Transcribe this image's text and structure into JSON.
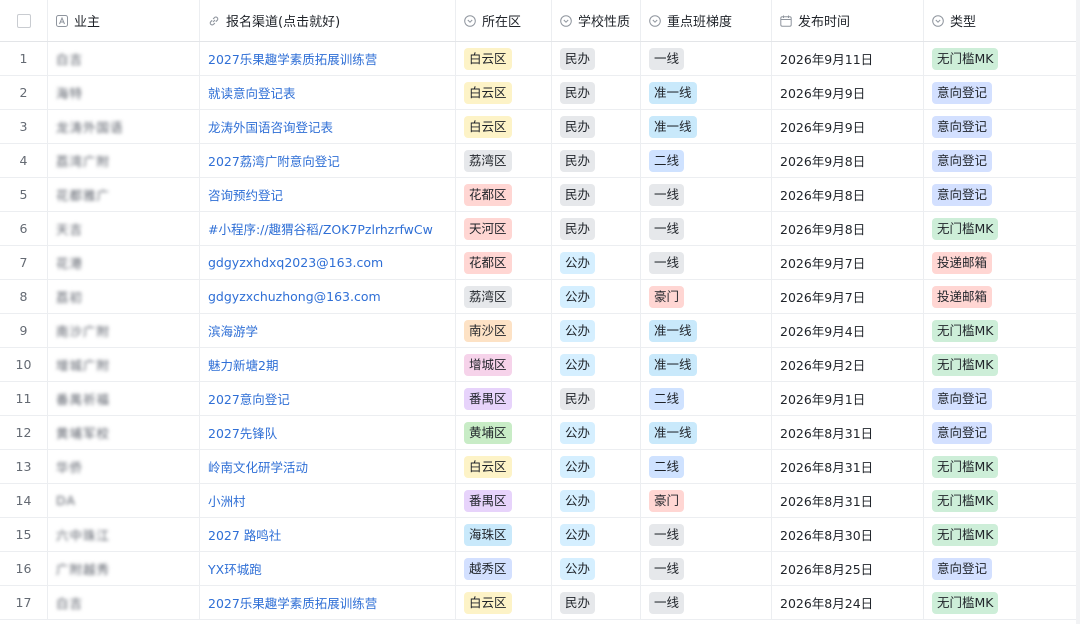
{
  "columns": [
    {
      "label": "",
      "icon": "checkbox-icon"
    },
    {
      "label": "业主",
      "icon": "text-field-icon"
    },
    {
      "label": "报名渠道(点击就好)",
      "icon": "link-icon"
    },
    {
      "label": "所在区",
      "icon": "dropdown-circle-icon"
    },
    {
      "label": "学校性质",
      "icon": "dropdown-circle-icon"
    },
    {
      "label": "重点班梯度",
      "icon": "dropdown-circle-icon"
    },
    {
      "label": "发布时间",
      "icon": "calendar-icon"
    },
    {
      "label": "类型",
      "icon": "dropdown-circle-icon"
    }
  ],
  "tag_colors": {
    "白云区": "#fdf3c7",
    "荔湾区": "#e6e8eb",
    "花都区": "#ffd6d3",
    "天河区": "#ffd6d3",
    "南沙区": "#fde2c5",
    "增城区": "#f6d3ea",
    "番禺区": "#e7d3fb",
    "黄埔区": "#c8ecc6",
    "海珠区": "#c9e9fb",
    "越秀区": "#d3e0ff",
    "民办": "#e6e8eb",
    "公办": "#d5efff",
    "一线": "#e6e8eb",
    "准一线": "#c9e9fb",
    "二线": "#cfe2ff",
    "豪门": "#ffd6d3",
    "无门槛MK": "#cdeed8",
    "意向登记": "#d3e0ff",
    "投递邮箱": "#ffd6d3"
  },
  "rows": [
    {
      "num": "1",
      "owner": "白吉",
      "channel": "2027乐果趣学素质拓展训练营",
      "district": "白云区",
      "nature": "民办",
      "tier": "一线",
      "date": "2026年9月11日",
      "type": "无门槛MK"
    },
    {
      "num": "2",
      "owner": "海特",
      "channel": "就读意向登记表",
      "district": "白云区",
      "nature": "民办",
      "tier": "准一线",
      "date": "2026年9月9日",
      "type": "意向登记"
    },
    {
      "num": "3",
      "owner": "龙涛外国语",
      "channel": "龙涛外国语咨询登记表",
      "district": "白云区",
      "nature": "民办",
      "tier": "准一线",
      "date": "2026年9月9日",
      "type": "意向登记"
    },
    {
      "num": "4",
      "owner": "荔湾广附",
      "channel": "2027荔湾广附意向登记",
      "district": "荔湾区",
      "nature": "民办",
      "tier": "二线",
      "date": "2026年9月8日",
      "type": "意向登记"
    },
    {
      "num": "5",
      "owner": "花都雅广",
      "channel": "咨询预约登记",
      "district": "花都区",
      "nature": "民办",
      "tier": "一线",
      "date": "2026年9月8日",
      "type": "意向登记"
    },
    {
      "num": "6",
      "owner": "天吉",
      "channel": "#小程序://趣猬谷稻/ZOK7PzlrhzrfwCw",
      "district": "天河区",
      "nature": "民办",
      "tier": "一线",
      "date": "2026年9月8日",
      "type": "无门槛MK"
    },
    {
      "num": "7",
      "owner": "花港",
      "channel": "gdgyzxhdxq2023@163.com",
      "district": "花都区",
      "nature": "公办",
      "tier": "一线",
      "date": "2026年9月7日",
      "type": "投递邮箱"
    },
    {
      "num": "8",
      "owner": "荔初",
      "channel": "gdgyzxchuzhong@163.com",
      "district": "荔湾区",
      "nature": "公办",
      "tier": "豪门",
      "date": "2026年9月7日",
      "type": "投递邮箱"
    },
    {
      "num": "9",
      "owner": "南沙广附",
      "channel": "滨海游学",
      "district": "南沙区",
      "nature": "公办",
      "tier": "准一线",
      "date": "2026年9月4日",
      "type": "无门槛MK"
    },
    {
      "num": "10",
      "owner": "增城广附",
      "channel": "魅力新塘2期",
      "district": "增城区",
      "nature": "公办",
      "tier": "准一线",
      "date": "2026年9月2日",
      "type": "无门槛MK"
    },
    {
      "num": "11",
      "owner": "番禺祈福",
      "channel": "2027意向登记",
      "district": "番禺区",
      "nature": "民办",
      "tier": "二线",
      "date": "2026年9月1日",
      "type": "意向登记"
    },
    {
      "num": "12",
      "owner": "黄埔军校",
      "channel": "2027先锋队",
      "district": "黄埔区",
      "nature": "公办",
      "tier": "准一线",
      "date": "2026年8月31日",
      "type": "意向登记"
    },
    {
      "num": "13",
      "owner": "华侨",
      "channel": "岭南文化研学活动",
      "district": "白云区",
      "nature": "公办",
      "tier": "二线",
      "date": "2026年8月31日",
      "type": "无门槛MK"
    },
    {
      "num": "14",
      "owner": "DA",
      "channel": "小洲村",
      "district": "番禺区",
      "nature": "公办",
      "tier": "豪门",
      "date": "2026年8月31日",
      "type": "无门槛MK"
    },
    {
      "num": "15",
      "owner": "六中珠江",
      "channel": "2027 路鸣社",
      "district": "海珠区",
      "nature": "公办",
      "tier": "一线",
      "date": "2026年8月30日",
      "type": "无门槛MK"
    },
    {
      "num": "16",
      "owner": "广附越秀",
      "channel": "YX环城跑",
      "district": "越秀区",
      "nature": "公办",
      "tier": "一线",
      "date": "2026年8月25日",
      "type": "意向登记"
    },
    {
      "num": "17",
      "owner": "白吉",
      "channel": "2027乐果趣学素质拓展训练营",
      "district": "白云区",
      "nature": "民办",
      "tier": "一线",
      "date": "2026年8月24日",
      "type": "无门槛MK"
    }
  ]
}
